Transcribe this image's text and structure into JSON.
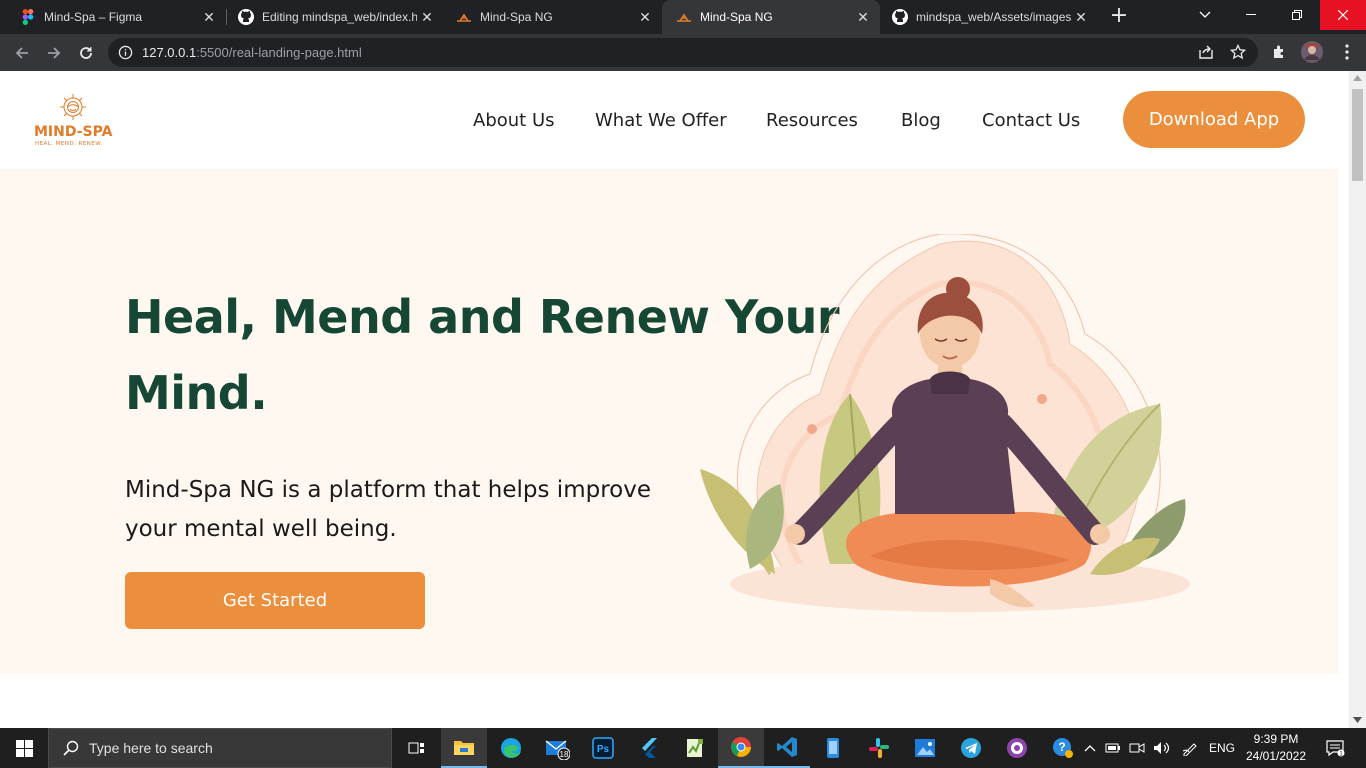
{
  "browser": {
    "tabs": [
      {
        "title": "Mind-Spa – Figma",
        "icon": "figma-icon",
        "active": false
      },
      {
        "title": "Editing mindspa_web/index.h",
        "icon": "github-icon",
        "active": false
      },
      {
        "title": "Mind-Spa NG",
        "icon": "mindspa-favicon",
        "active": false
      },
      {
        "title": "Mind-Spa NG",
        "icon": "mindspa-favicon",
        "active": true
      },
      {
        "title": "mindspa_web/Assets/images",
        "icon": "github-icon",
        "active": false
      }
    ],
    "url_host": "127.0.0.1",
    "url_rest": ":5500/real-landing-page.html"
  },
  "site": {
    "logo_text": "MIND-SPA",
    "logo_tagline": "HEAL. MEND. RENEW.",
    "nav": [
      "About Us",
      "What We Offer",
      "Resources",
      "Blog",
      "Contact Us"
    ],
    "download_button": "Download App",
    "hero": {
      "title_line1": "Heal, Mend and Renew Your",
      "title_line2": "Mind.",
      "subtitle_line1": "Mind-Spa NG is a platform that helps improve",
      "subtitle_line2": "your mental well being.",
      "cta": "Get Started"
    },
    "colors": {
      "brand_orange": "#ec8f3c",
      "heading_green": "#154734",
      "hero_bg": "#fff8f1"
    }
  },
  "taskbar": {
    "search_placeholder": "Type here to search",
    "apps": [
      "task-view-icon",
      "file-explorer-icon",
      "edge-icon",
      "mail-icon",
      "photoshop-icon",
      "flutter-icon",
      "notepad-icon",
      "chrome-icon",
      "vscode-icon",
      "phone-icon",
      "slack-icon",
      "photos-icon",
      "telegram-icon",
      "github-desktop-icon"
    ],
    "mail_badge": "18",
    "language": "ENG",
    "time": "9:39 PM",
    "date": "24/01/2022"
  }
}
